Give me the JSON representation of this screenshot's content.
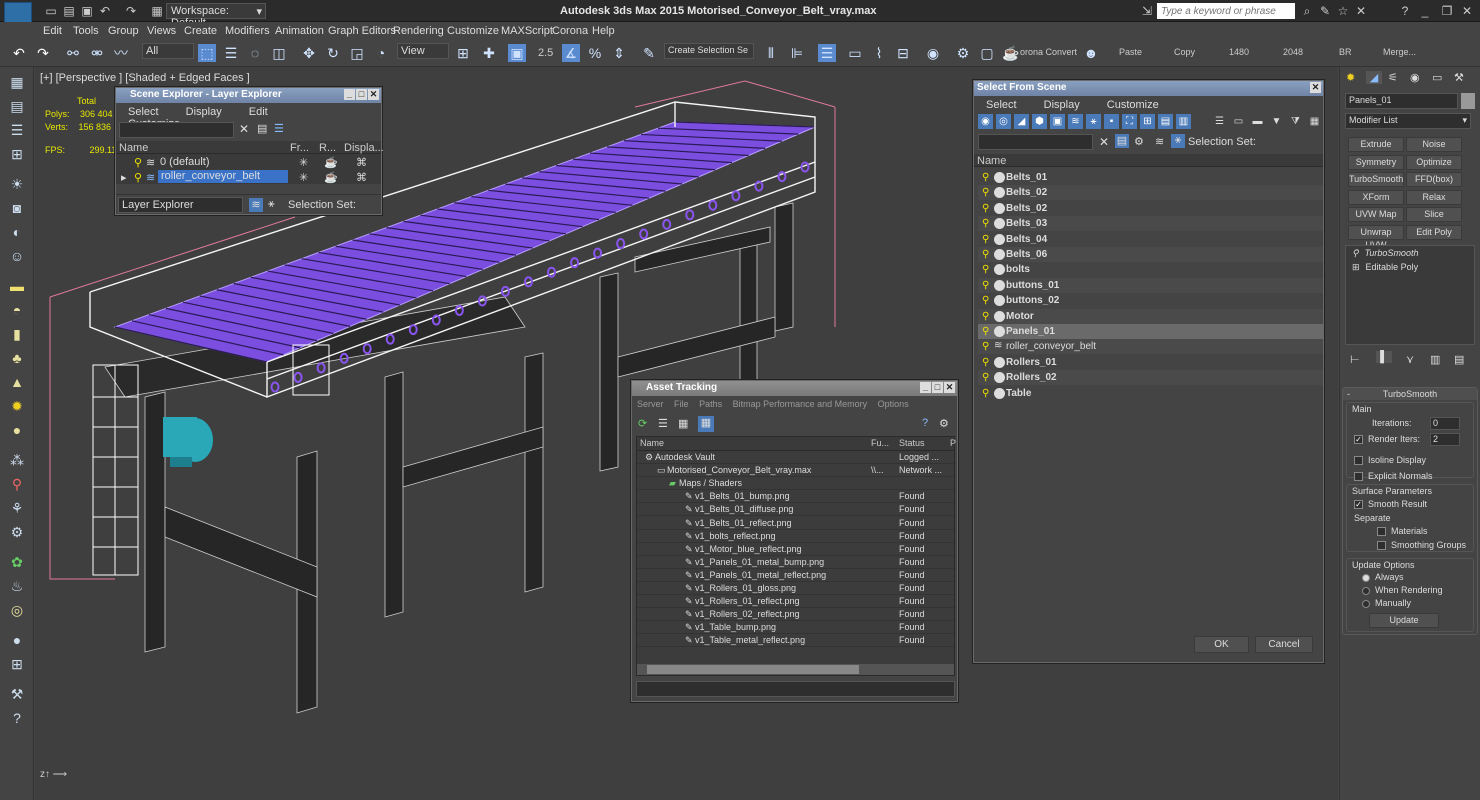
{
  "app": {
    "title": "Autodesk 3ds Max  2015    Motorised_Conveyor_Belt_vray.max",
    "workspace": "Workspace: Default",
    "search_placeholder": "Type a keyword or phrase",
    "logo": "MAX"
  },
  "menu": [
    "Edit",
    "Tools",
    "Group",
    "Views",
    "Create",
    "Modifiers",
    "Animation",
    "Graph Editors",
    "Rendering",
    "Customize",
    "MAXScript",
    "Corona",
    "Help"
  ],
  "toolbar": {
    "filter": "All",
    "view": "View",
    "selection_set": "Create Selection Se",
    "snap_value": "2.5",
    "corona_label": "orona Convert",
    "paste": "Paste",
    "copy": "Copy",
    "w": "1480",
    "h": "2048",
    "br": "BR",
    "merge": "Merge..."
  },
  "viewport": {
    "label": "[+] [Perspective ] [Shaded + Edged Faces ]",
    "stats": {
      "total": "Total",
      "polys_label": "Polys:",
      "polys": "306 404",
      "verts_label": "Verts:",
      "verts": "156 836",
      "fps_label": "FPS:",
      "fps": "299.118"
    }
  },
  "scene_explorer": {
    "title": "Scene Explorer - Layer Explorer",
    "menu": [
      "Select",
      "Display",
      "Edit",
      "Customize"
    ],
    "cols": [
      "Name",
      "Fr...",
      "R...",
      "Displa..."
    ],
    "rows": [
      "0 (default)",
      "roller_conveyor_belt"
    ],
    "footer_layer": "Layer Explorer",
    "footer_sel": "Selection Set:"
  },
  "select_from_scene": {
    "title": "Select From Scene",
    "menu": [
      "Select",
      "Display",
      "Customize"
    ],
    "selection_set": "Selection Set:",
    "col_name": "Name",
    "items": [
      "Belts_01",
      "Belts_02",
      "Belts_02",
      "Belts_03",
      "Belts_04",
      "Belts_06",
      "bolts",
      "buttons_01",
      "buttons_02",
      "Motor",
      "Panels_01",
      "roller_conveyor_belt",
      "Rollers_01",
      "Rollers_02",
      "Table"
    ],
    "ok": "OK",
    "cancel": "Cancel"
  },
  "asset_tracking": {
    "title": "Asset Tracking",
    "menu": [
      "Server",
      "File",
      "Paths",
      "Bitmap Performance and Memory",
      "Options"
    ],
    "cols": [
      "Name",
      "Fu...",
      "Status",
      "P"
    ],
    "rows": [
      {
        "name": "Autodesk Vault",
        "fu": "",
        "status": "Logged ..."
      },
      {
        "name": "Motorised_Conveyor_Belt_vray.max",
        "fu": "\\\\...",
        "status": "Network ..."
      },
      {
        "name": "Maps / Shaders",
        "fu": "",
        "status": ""
      },
      {
        "name": "v1_Belts_01_bump.png",
        "fu": "",
        "status": "Found"
      },
      {
        "name": "v1_Belts_01_diffuse.png",
        "fu": "",
        "status": "Found"
      },
      {
        "name": "v1_Belts_01_reflect.png",
        "fu": "",
        "status": "Found"
      },
      {
        "name": "v1_bolts_reflect.png",
        "fu": "",
        "status": "Found"
      },
      {
        "name": "v1_Motor_blue_reflect.png",
        "fu": "",
        "status": "Found"
      },
      {
        "name": "v1_Panels_01_metal_bump.png",
        "fu": "",
        "status": "Found"
      },
      {
        "name": "v1_Panels_01_metal_reflect.png",
        "fu": "",
        "status": "Found"
      },
      {
        "name": "v1_Rollers_01_gloss.png",
        "fu": "",
        "status": "Found"
      },
      {
        "name": "v1_Rollers_01_reflect.png",
        "fu": "",
        "status": "Found"
      },
      {
        "name": "v1_Rollers_02_reflect.png",
        "fu": "",
        "status": "Found"
      },
      {
        "name": "v1_Table_bump.png",
        "fu": "",
        "status": "Found"
      },
      {
        "name": "v1_Table_metal_reflect.png",
        "fu": "",
        "status": "Found"
      }
    ]
  },
  "command_panel": {
    "object_name": "Panels_01",
    "modifier_list": "Modifier List",
    "buttons": [
      "Extrude",
      "Noise",
      "Symmetry",
      "Optimize",
      "TurboSmooth",
      "FFD(box)",
      "XForm",
      "Relax",
      "UVW Map",
      "Slice",
      "Unwrap UVW",
      "Edit Poly"
    ],
    "stack": [
      "TurboSmooth",
      "Editable Poly"
    ],
    "rollout_title": "TurboSmooth",
    "main": "Main",
    "iterations_label": "Iterations:",
    "iterations": "0",
    "render_iters_label": "Render Iters:",
    "render_iters": "2",
    "isoline": "Isoline Display",
    "explicit_normals": "Explicit Normals",
    "surface_params": "Surface Parameters",
    "smooth_result": "Smooth Result",
    "separate": "Separate",
    "materials": "Materials",
    "smoothing_groups": "Smoothing Groups",
    "update_options": "Update Options",
    "always": "Always",
    "when_rendering": "When Rendering",
    "manually": "Manually",
    "update": "Update"
  },
  "colors": {
    "accent": "#4a7ab8",
    "roller": "#8a55ee",
    "motor": "#2aa8b8",
    "wire": "#ffffff",
    "bbox": "#e07a9a"
  }
}
